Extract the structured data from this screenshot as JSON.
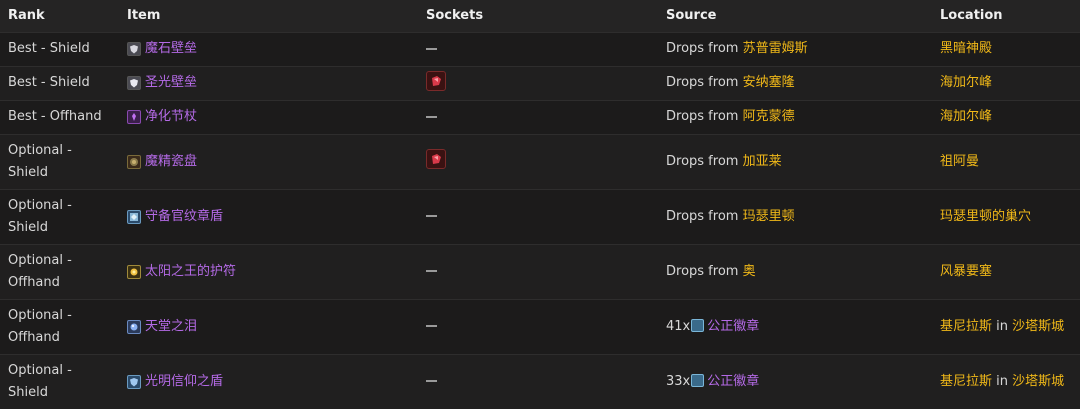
{
  "headers": {
    "rank": "Rank",
    "item": "Item",
    "sockets": "Sockets",
    "source": "Source",
    "location": "Location"
  },
  "rows": [
    {
      "rank": "Best - Shield",
      "item": "魔石壁垒",
      "icon": "shield-icon",
      "socket": "none",
      "source_prefix": "Drops from",
      "source_name": "苏普雷姆斯",
      "location": "黑暗神殿"
    },
    {
      "rank": "Best - Shield",
      "item": "圣光壁垒",
      "icon": "shield-icon",
      "socket": "red-gem",
      "source_prefix": "Drops from",
      "source_name": "安纳塞隆",
      "location": "海加尔峰"
    },
    {
      "rank": "Best - Offhand",
      "item": "净化节杖",
      "icon": "scepter-icon",
      "socket": "none",
      "source_prefix": "Drops from",
      "source_name": "阿克蒙德",
      "location": "海加尔峰"
    },
    {
      "rank": "Optional - Shield",
      "item": "魔精瓷盘",
      "icon": "shield-icon",
      "socket": "red-gem",
      "source_prefix": "Drops from",
      "source_name": "加亚莱",
      "location": "祖阿曼"
    },
    {
      "rank": "Optional - Shield",
      "item": "守备官纹章盾",
      "icon": "shield-icon",
      "socket": "none",
      "source_prefix": "Drops from",
      "source_name": "玛瑟里顿",
      "location": "玛瑟里顿的巢穴"
    },
    {
      "rank": "Optional - Offhand",
      "item": "太阳之王的护符",
      "icon": "talisman-icon",
      "socket": "none",
      "source_prefix": "Drops from",
      "source_name": "奥",
      "location": "风暴要塞"
    },
    {
      "rank": "Optional - Offhand",
      "item": "天堂之泪",
      "icon": "orb-icon",
      "socket": "none",
      "source_prefix": "41x",
      "source_badge": "公正徽章",
      "location": "基尼拉斯",
      "location_sep": "in",
      "location2": "沙塔斯城"
    },
    {
      "rank": "Optional - Shield",
      "item": "光明信仰之盾",
      "icon": "shield-icon",
      "socket": "none",
      "source_prefix": "33x",
      "source_badge": "公正徽章",
      "location": "基尼拉斯",
      "location_sep": "in",
      "location2": "沙塔斯城"
    }
  ],
  "colors": {
    "item_epic": "#b46ae6",
    "npc_gold": "#f0b818",
    "background": "#1a1919",
    "header_bg": "#252424"
  }
}
